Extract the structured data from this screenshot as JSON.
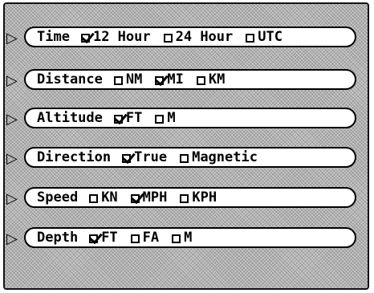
{
  "menu": {
    "rows": [
      {
        "label": "Time",
        "options": [
          {
            "text": "12 Hour",
            "checked": true
          },
          {
            "text": "24 Hour",
            "checked": false
          },
          {
            "text": "UTC",
            "checked": false
          }
        ]
      },
      {
        "label": "Distance",
        "options": [
          {
            "text": "NM",
            "checked": false
          },
          {
            "text": "MI",
            "checked": true
          },
          {
            "text": "KM",
            "checked": false
          }
        ]
      },
      {
        "label": "Altitude",
        "options": [
          {
            "text": "FT",
            "checked": true
          },
          {
            "text": "M",
            "checked": false
          }
        ]
      },
      {
        "label": "Direction",
        "options": [
          {
            "text": "True",
            "checked": true
          },
          {
            "text": "Magnetic",
            "checked": false
          }
        ]
      },
      {
        "label": "Speed",
        "options": [
          {
            "text": "KN",
            "checked": false
          },
          {
            "text": "MPH",
            "checked": true
          },
          {
            "text": "KPH",
            "checked": false
          }
        ]
      },
      {
        "label": "Depth",
        "options": [
          {
            "text": "FT",
            "checked": true
          },
          {
            "text": "FA",
            "checked": false
          },
          {
            "text": "M",
            "checked": false
          }
        ]
      }
    ]
  }
}
